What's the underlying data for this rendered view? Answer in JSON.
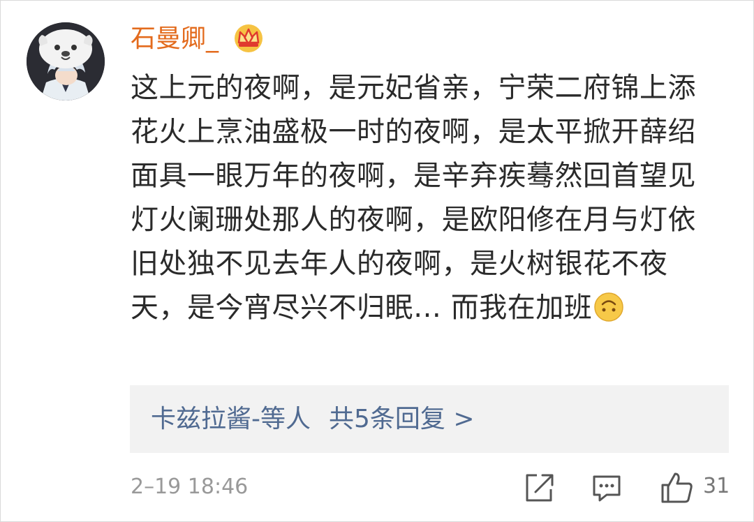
{
  "post": {
    "username": "石曼卿_",
    "badge_icon": "crown-icon",
    "comment_text": "这上元的夜啊，是元妃省亲，宁荣二府锦上添花火上烹油盛极一时的夜啊，是太平掀开薛绍面具一眼万年的夜啊，是辛弃疾蓦然回首望见灯火阑珊处那人的夜啊，是欧阳修在月与灯依旧处独不见去年人的夜啊，是火树银花不夜天，是今宵尽兴不归眠… 而我在加班",
    "emoji_icon": "upside-down-face-emoji",
    "timestamp": "2–19 18:46",
    "like_count": "31"
  },
  "replies": {
    "participants": "卡兹拉酱-等人",
    "count_label": "共5条回复 >"
  },
  "colors": {
    "username": "#e36b1d",
    "reply_link": "#506a91",
    "reply_bg": "#f2f2f2",
    "meta": "#999999"
  }
}
